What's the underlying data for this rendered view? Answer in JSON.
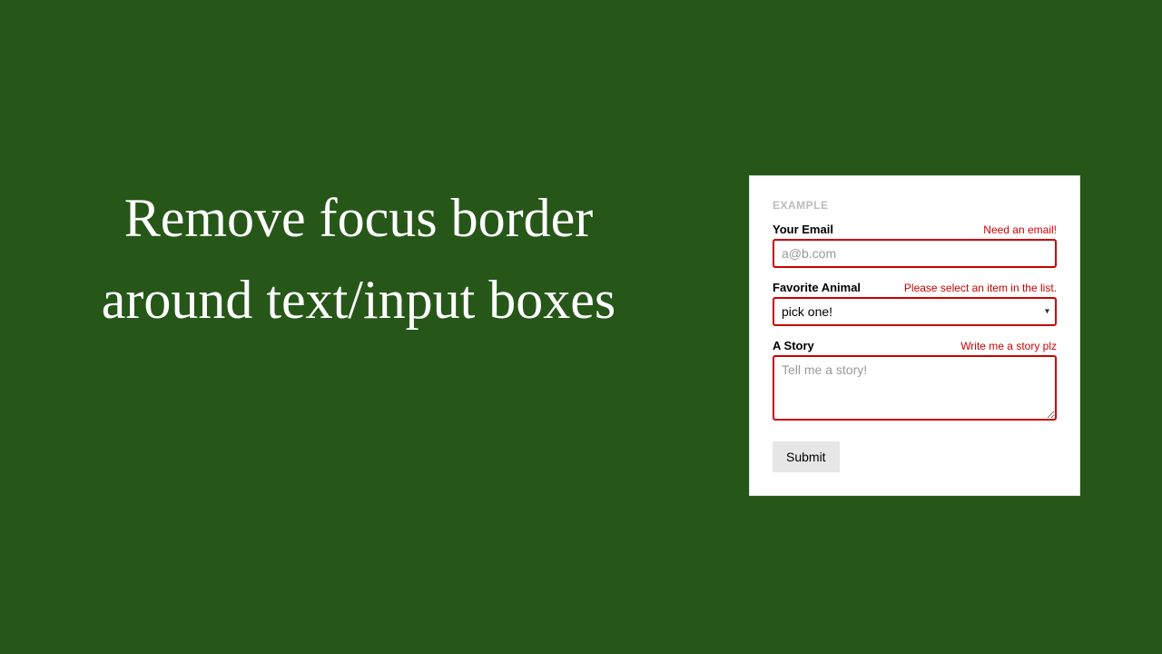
{
  "title": "Remove focus border around text/input boxes",
  "form": {
    "header": "EXAMPLE",
    "email": {
      "label": "Your Email",
      "error": "Need an email!",
      "placeholder": "a@b.com",
      "value": ""
    },
    "animal": {
      "label": "Favorite Animal",
      "error": "Please select an item in the list.",
      "selected": "pick one!"
    },
    "story": {
      "label": "A Story",
      "error": "Write me a story plz",
      "placeholder": "Tell me a story!",
      "value": ""
    },
    "submit_label": "Submit"
  },
  "colors": {
    "background": "#265719",
    "error": "#c00",
    "title": "#ffffff"
  }
}
